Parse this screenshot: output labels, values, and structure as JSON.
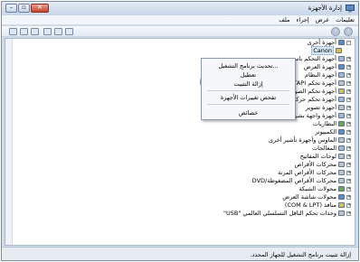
{
  "window": {
    "title": "إدارة الأجهزة"
  },
  "menu": [
    "ملف",
    "إجراء",
    "عرض",
    "تعليمات"
  ],
  "tree": {
    "root": "أجهزة أخرى",
    "selected": "Canon",
    "items": [
      "أجهزة التحكم باسم",
      "أجهزة العرض",
      "أجهزة النظام",
      "أجهزة تحكم ATAPI",
      "أجهزة تحكم الصوت",
      "أجهزة تحكم حركة",
      "أجهزة تصوير",
      "أجهزة واجهة بشرية",
      "البطاريات",
      "الكمبيوتر",
      "الماوس وأجهزة تأشير أخرى",
      "المعالجات",
      "لوحات المفاتيح",
      "محركات الأقراص",
      "محركات الأقراص المرنة",
      "محركات الأقراص المضغوطة/DVD",
      "محولات الشبكة",
      "محولات شاشة العرض",
      "منافذ (COM & LPT)",
      "وحدات تحكم الناقل التسلسلي العالمي \"USB\""
    ]
  },
  "context_menu": {
    "items": [
      "تحديث برنامج التشغيل...",
      "تعطيل",
      "إزالة التثبيت",
      "تفحص تغييرات الأجهزة",
      "خصائص"
    ]
  },
  "status": "إزالة تثبيت برنامج التشغيل للجهاز المحدد."
}
